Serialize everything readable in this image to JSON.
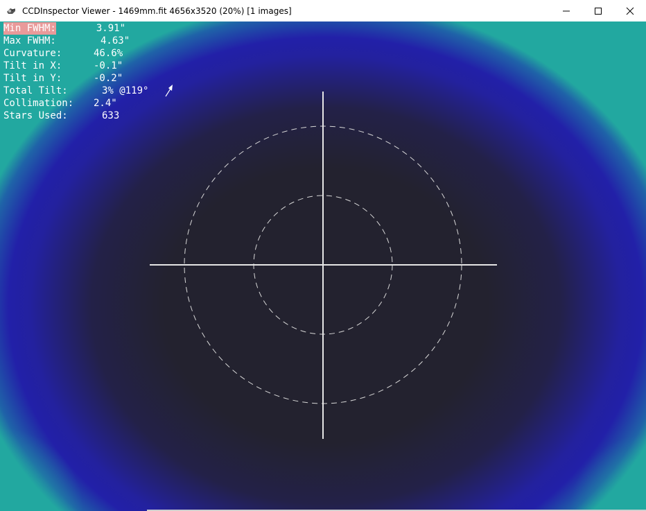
{
  "window": {
    "title": "CCDInspector Viewer - 1469mm.fit 4656x3520 (20%)  [1 images]",
    "app_icon": "ccdinspector-app-icon",
    "buttons": {
      "minimize": "minimize-icon",
      "maximize": "maximize-icon",
      "close": "close-icon"
    }
  },
  "stats": [
    {
      "label": "Min FWHM:",
      "value": "3.91\"",
      "highlight": true
    },
    {
      "label": "Max FWHM:",
      "value": "4.63\""
    },
    {
      "label": "Curvature:",
      "value": "46.6%"
    },
    {
      "label": "Tilt in X:",
      "value": "-0.1\""
    },
    {
      "label": "Tilt in Y:",
      "value": "-0.2\""
    },
    {
      "label": "Total Tilt:",
      "value": "3% @119°"
    },
    {
      "label": "Collimation:",
      "value": "2.4\""
    },
    {
      "label": "Stars Used:",
      "value": "633"
    }
  ],
  "overlay": {
    "tilt_arrow": "tilt-direction-arrow-icon",
    "crosshair": "crosshair",
    "colors": {
      "line": "#e6e6e6",
      "center": "#23222f",
      "edge_blue": "#2220a8",
      "corner_teal": "#22a8a0"
    }
  }
}
